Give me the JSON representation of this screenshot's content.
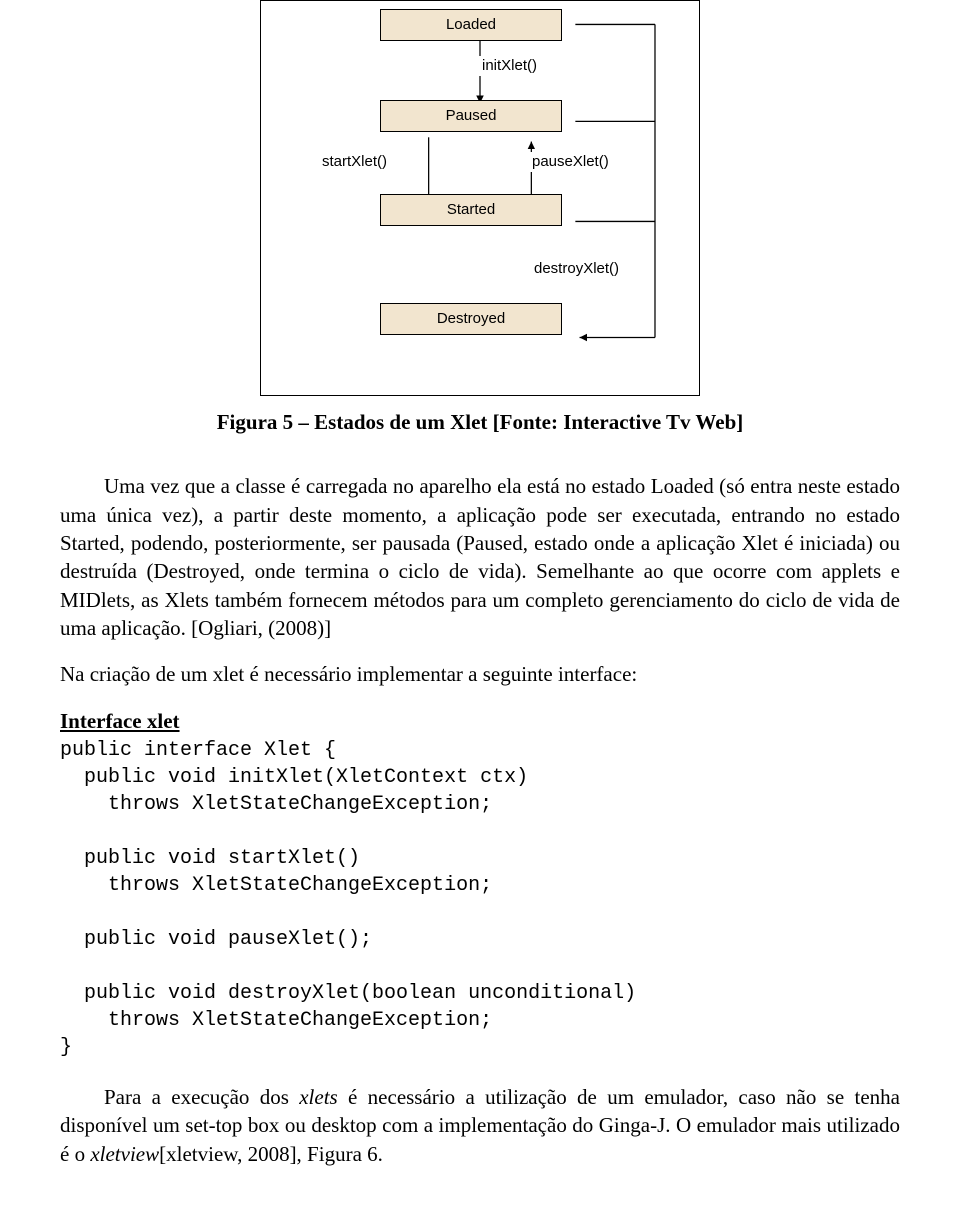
{
  "diagram": {
    "states": {
      "loaded": "Loaded",
      "paused": "Paused",
      "started": "Started",
      "destroyed": "Destroyed"
    },
    "transitions": {
      "initXlet": "initXlet()",
      "startXlet": "startXlet()",
      "pauseXlet": "pauseXlet()",
      "destroyXlet": "destroyXlet()"
    }
  },
  "caption": "Figura 5 – Estados de um Xlet [Fonte: Interactive Tv Web]",
  "para1": "Uma vez que a classe é carregada no aparelho ela está no estado Loaded (só entra neste estado uma única vez), a partir deste momento, a aplicação pode ser executada, entrando no estado Started, podendo, posteriormente, ser pausada (Paused, estado onde a aplicação Xlet é iniciada) ou destruída (Destroyed, onde termina o ciclo de vida). Semelhante ao que ocorre com applets e MIDlets, as Xlets também fornecem métodos para um completo gerenciamento do ciclo de vida de uma aplicação. [Ogliari, (2008)]",
  "para2": "Na criação de um xlet é necessário implementar a seguinte interface:",
  "interfaceHeading": "Interface xlet",
  "code": "public interface Xlet {\n  public void initXlet(XletContext ctx)\n    throws XletStateChangeException;\n\n  public void startXlet()\n    throws XletStateChangeException;\n\n  public void pauseXlet();\n\n  public void destroyXlet(boolean unconditional)\n    throws XletStateChangeException;\n}",
  "para3_a": "Para a execução dos ",
  "para3_b": "xlets",
  "para3_c": " é necessário a utilização de um emulador, caso não se tenha disponível um set-top box ou desktop com a implementação do Ginga-J. O emulador mais utilizado é o ",
  "para3_d": "xletview",
  "para3_e": "[xletview, 2008], Figura 6."
}
